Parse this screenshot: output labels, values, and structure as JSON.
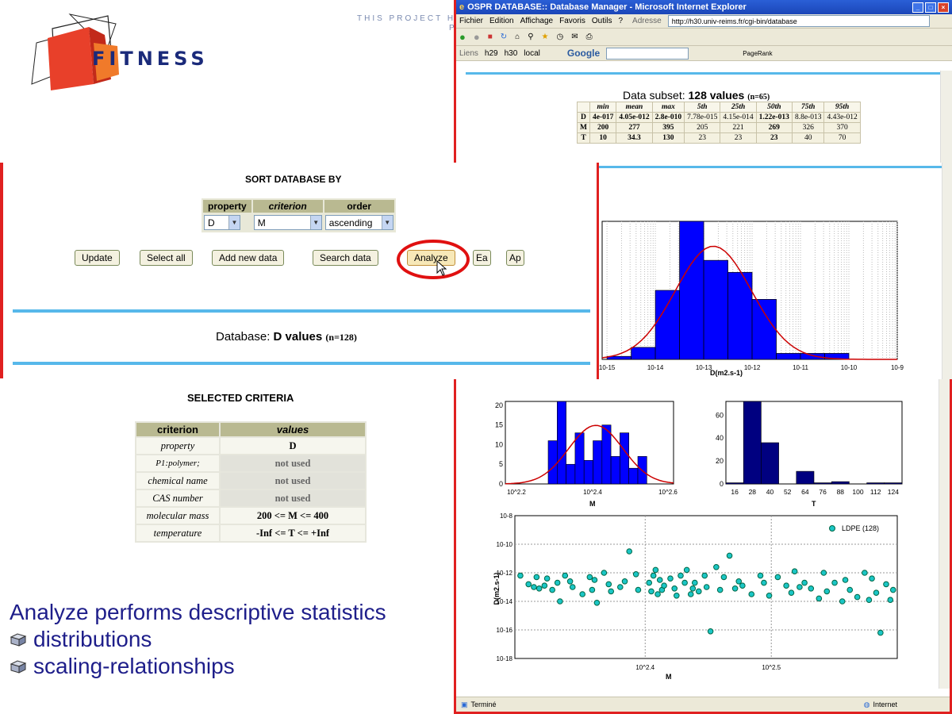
{
  "logo": {
    "text": "FITNESS",
    "brand_color": "#e8452a"
  },
  "banner": {
    "text": "THIS PROJECT HAS",
    "text2": "P"
  },
  "sort": {
    "title": "SORT DATABASE BY",
    "headers": [
      "property",
      "criterion",
      "order"
    ],
    "property_value": "D",
    "criterion_value": "M",
    "order_value": "ascending",
    "buttons": [
      "Update",
      "Select all",
      "Add new data",
      "Search data",
      "Analyze",
      "Ea",
      "Ap"
    ]
  },
  "database": {
    "label": "Database: ",
    "bold": "D values",
    "count": "(n=128)"
  },
  "criteria": {
    "title": "SELECTED CRITERIA",
    "headers": [
      "criterion",
      "values"
    ],
    "rows": [
      [
        "property",
        "D"
      ],
      [
        "P1:polymer;",
        "not used"
      ],
      [
        "chemical name",
        "not used"
      ],
      [
        "CAS number",
        "not used"
      ],
      [
        "molecular mass",
        "200 <= M <=  400"
      ],
      [
        "temperature",
        "-Inf <= T <= +Inf"
      ]
    ]
  },
  "bottom": {
    "heading": "Analyze performs descriptive statistics",
    "bullets": [
      "distributions",
      "scaling-relationships"
    ]
  },
  "browser": {
    "title": "OSPR DATABASE:: Database Manager - Microsoft Internet Explorer",
    "menu": [
      "Fichier",
      "Edition",
      "Affichage",
      "Favoris",
      "Outils",
      "?"
    ],
    "address_label": "Adresse",
    "address": "http://h30.univ-reims.fr/cgi-bin/database",
    "links": [
      "Liens",
      "h29",
      "h30",
      "local"
    ],
    "google": "Google",
    "pagerank": "PageRank",
    "status": "Terminé",
    "zone": "Internet"
  },
  "subset": {
    "label": "Data subset: ",
    "bold": "128 values",
    "count": "(n=65)",
    "headers": [
      "",
      "min",
      "mean",
      "max",
      "5th",
      "25th",
      "50th",
      "75th",
      "95th"
    ],
    "rows": [
      [
        "D",
        "4e-017",
        "4.05e-012",
        "2.8e-010",
        "7.78e-015",
        "4.15e-014",
        "1.22e-013",
        "8.8e-013",
        "4.43e-012"
      ],
      [
        "M",
        "200",
        "277",
        "395",
        "205",
        "221",
        "269",
        "326",
        "370"
      ],
      [
        "T",
        "10",
        "34.3",
        "130",
        "23",
        "23",
        "23",
        "40",
        "70"
      ]
    ]
  },
  "chart_data": [
    {
      "type": "bar",
      "title": "",
      "xlabel": "D(m2.s-1)",
      "xscale": "log",
      "xticks": [
        "10-15",
        "10-14",
        "10-13",
        "10-12",
        "10-11",
        "10-10",
        "10-9"
      ],
      "bin_edges_log10": [
        -15,
        -14.5,
        -14,
        -13.5,
        -13,
        -12.5,
        -12,
        -11.5,
        -11,
        -10.5,
        -10,
        -9.5
      ],
      "values": [
        1,
        4,
        23,
        46,
        33,
        29,
        20,
        2,
        2,
        2,
        0
      ],
      "fit": "normal curve",
      "bar_color": "#0000ff",
      "fit_color": "#cc0000"
    },
    {
      "type": "bar",
      "xlabel": "M",
      "xscale": "log",
      "xticks": [
        "10^2.2",
        "10^2.4",
        "10^2.6"
      ],
      "yticks": [
        0,
        5,
        10,
        15,
        20
      ],
      "ylim": [
        0,
        21
      ],
      "values": [
        11,
        21,
        5,
        13,
        6,
        11,
        15,
        7,
        13,
        4,
        7
      ],
      "fit": "normal curve",
      "bar_color": "#0000ff"
    },
    {
      "type": "bar",
      "xlabel": "T",
      "xticks": [
        16,
        28,
        40,
        52,
        64,
        76,
        88,
        100,
        112,
        124
      ],
      "yticks": [
        0,
        20,
        40,
        60
      ],
      "ylim": [
        0,
        72
      ],
      "values": [
        1,
        72,
        36,
        0,
        11,
        1,
        2,
        0,
        1,
        1
      ],
      "bar_color": "#000080"
    },
    {
      "type": "scatter",
      "xlabel": "M",
      "ylabel": "D(m2.s-1)",
      "xscale": "log",
      "yscale": "log",
      "xticks": [
        "10^2.4",
        "10^2.5"
      ],
      "yticks": [
        "10-8",
        "10-10",
        "10-12",
        "10-14",
        "10-16",
        "10-18"
      ],
      "legend": "LDPE (128)",
      "legend_position": "top-right",
      "marker_color": "#1bc6c6",
      "series": [
        {
          "name": "LDPE (128)",
          "x": [
            200,
            203,
            205,
            206,
            207,
            209,
            210,
            212,
            214,
            215,
            217,
            219,
            220,
            224,
            227,
            228,
            229,
            230,
            233,
            235,
            236,
            240,
            242,
            244,
            247,
            248,
            253,
            254,
            255,
            256,
            257,
            258,
            259,
            260,
            263,
            265,
            266,
            268,
            270,
            271,
            273,
            274,
            275,
            277,
            280,
            281,
            283,
            286,
            288,
            290,
            293,
            296,
            298,
            300,
            305,
            310,
            312,
            315,
            320,
            325,
            328,
            330,
            333,
            336,
            340,
            345,
            348,
            350,
            355,
            360,
            362,
            365,
            370,
            375,
            378,
            380,
            383,
            386,
            390,
            393,
            395
          ],
          "y": [
            -12.2,
            -12.8,
            -13.0,
            -12.3,
            -13.1,
            -12.9,
            -12.4,
            -13.2,
            -12.7,
            -14.0,
            -12.2,
            -12.6,
            -13.0,
            -13.5,
            -12.3,
            -13.2,
            -12.5,
            -14.1,
            -12.0,
            -12.8,
            -13.3,
            -13.0,
            -12.6,
            -10.5,
            -12.1,
            -13.2,
            -12.7,
            -13.3,
            -12.2,
            -11.8,
            -13.5,
            -12.5,
            -13.2,
            -12.9,
            -12.4,
            -13.1,
            -13.6,
            -12.2,
            -12.7,
            -11.8,
            -13.5,
            -13.1,
            -12.7,
            -13.3,
            -12.2,
            -13.0,
            -16.1,
            -11.6,
            -13.2,
            -12.3,
            -10.8,
            -13.1,
            -12.6,
            -12.9,
            -13.5,
            -12.2,
            -12.7,
            -13.6,
            -12.3,
            -12.9,
            -13.4,
            -11.9,
            -13.0,
            -12.7,
            -13.1,
            -13.8,
            -12.0,
            -13.3,
            -12.7,
            -14.0,
            -12.5,
            -13.2,
            -13.7,
            -12.0,
            -13.9,
            -12.4,
            -13.4,
            -16.2,
            -12.8,
            -13.9,
            -13.2
          ]
        }
      ]
    }
  ]
}
